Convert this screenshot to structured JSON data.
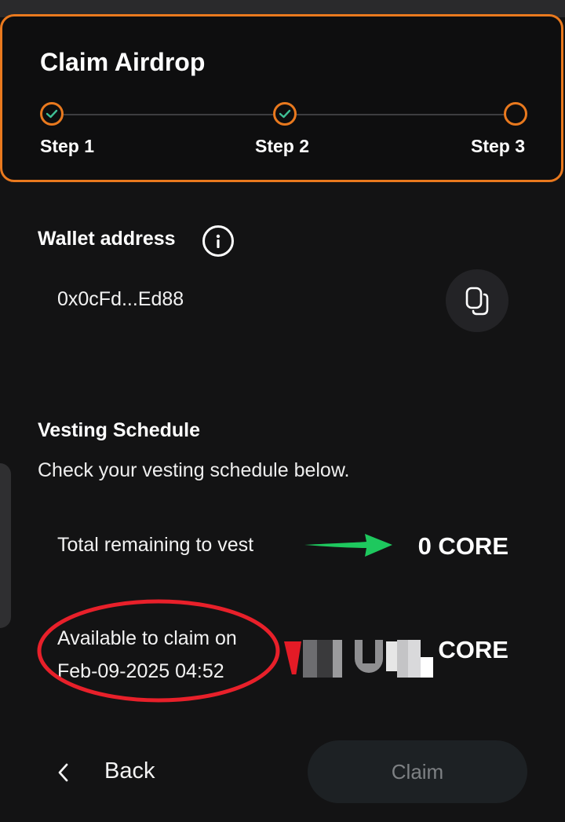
{
  "header": {
    "title": "Claim Airdrop",
    "steps": [
      {
        "label": "Step 1",
        "status": "complete"
      },
      {
        "label": "Step 2",
        "status": "complete"
      },
      {
        "label": "Step 3",
        "status": "current"
      }
    ]
  },
  "wallet": {
    "heading": "Wallet address",
    "address": "0x0cFd...Ed88",
    "info_icon": "info-icon",
    "copy_icon": "copy-icon"
  },
  "vesting": {
    "heading": "Vesting Schedule",
    "subtitle": "Check your vesting schedule below.",
    "remaining_label": "Total remaining to vest",
    "remaining_value": "0 CORE",
    "available_label_line1": "Available to claim on",
    "available_label_line2": "Feb-09-2025 04:52",
    "available_value_suffix": "CORE"
  },
  "footer": {
    "back_label": "Back",
    "back_icon": "chevron-left-icon",
    "claim_label": "Claim"
  },
  "colors": {
    "accent": "#e9791e",
    "check": "#3fbf95",
    "background": "#131314",
    "annotation_arrow": "#1ec85e",
    "annotation_circle": "#e8202a"
  }
}
